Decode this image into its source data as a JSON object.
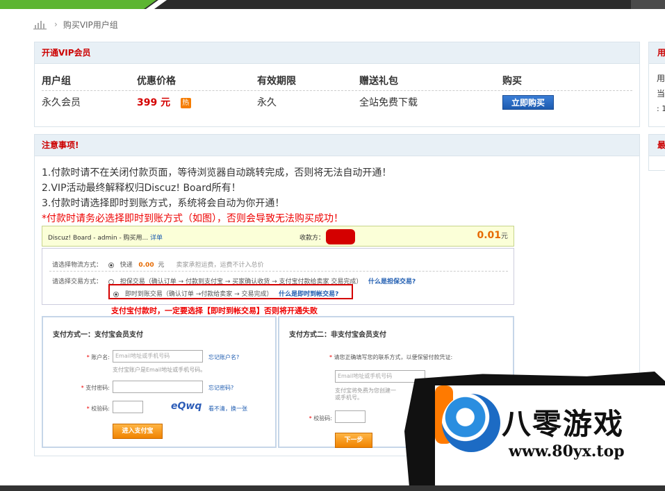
{
  "breadcrumb": {
    "current": "购买VIP用户组"
  },
  "vip_panel": {
    "title": "开通VIP会员",
    "columns": [
      "用户组",
      "优惠价格",
      "有效期限",
      "赠送礼包",
      "购买"
    ],
    "row": {
      "group": "永久会员",
      "price": "399 元",
      "hot_badge": "热",
      "period": "永久",
      "gift": "全站免费下载",
      "buy_label": "立即购买"
    }
  },
  "notice_panel": {
    "title": "注意事项!",
    "lines": [
      "1.付款时请不在关闭付款页面，等待浏览器自动跳转完成，否则将无法自动开通！",
      "2.VIP活动最终解释权归Discuz! Board所有！",
      "3.付款时请选择即时到账方式，系统将会自动为你开通！"
    ],
    "warning": "*付款时请务必选择即时到账方式（如图），否则会导致无法购买成功！"
  },
  "alipay_shot": {
    "order_text": "Discuz! Board - admin - 购买用...",
    "detail_link": "详单",
    "payee_label": "收款方：",
    "amount": "0.01",
    "amount_unit": "元",
    "logistics_label": "请选择物流方式：",
    "logistics_option": "快递",
    "logistics_price": "0.00",
    "logistics_unit": "元",
    "logistics_note": "卖家承担运费，运费不计入总价",
    "trade_label": "请选择交易方式：",
    "trade_option1": "担保交易（确认订单 → 付款到支付宝 → 买家确认收货 → 支付宝付款给卖家 交易完成）",
    "trade_option1_link": "什么是担保交易?",
    "trade_option2": "即时到账交易（确认订单 →付款给卖家 → 交易完成）",
    "trade_option2_link": "什么是即时到帐交易?",
    "warning": "支付宝付款时，一定要选择【即时到帐交易】否则将开通失败",
    "pay1": {
      "title": "支付方式一：支付宝会员支付",
      "account_label": "账户名:",
      "account_placeholder": "Email地址或手机号码",
      "account_hint": "支付宝账户是Email地址或手机号码。",
      "forgot_account": "忘记账户名?",
      "password_label": "支付密码:",
      "forgot_password": "忘记密码?",
      "captcha_label": "校验码:",
      "captcha_text": "eQwq",
      "captcha_refresh": "看不清，换一张",
      "submit": "进入支付宝"
    },
    "pay2": {
      "title": "支付方式二：非支付宝会员支付",
      "contact_label": "请您正确填写您的联系方式，以便保留付款凭证:",
      "contact_placeholder": "Email地址或手机号码",
      "contact_hint": "支付宝将免费为您创建一",
      "contact_hint2": "或手机号。",
      "captcha_label": "校验码:",
      "next": "下一步"
    }
  },
  "right_panel": {
    "title": "用",
    "lines": [
      "用",
      "当",
      ": 1"
    ]
  },
  "right_panel2": {
    "title": "最"
  },
  "watermark": {
    "cn": "八零游戏",
    "url": "www.80yx.top"
  }
}
